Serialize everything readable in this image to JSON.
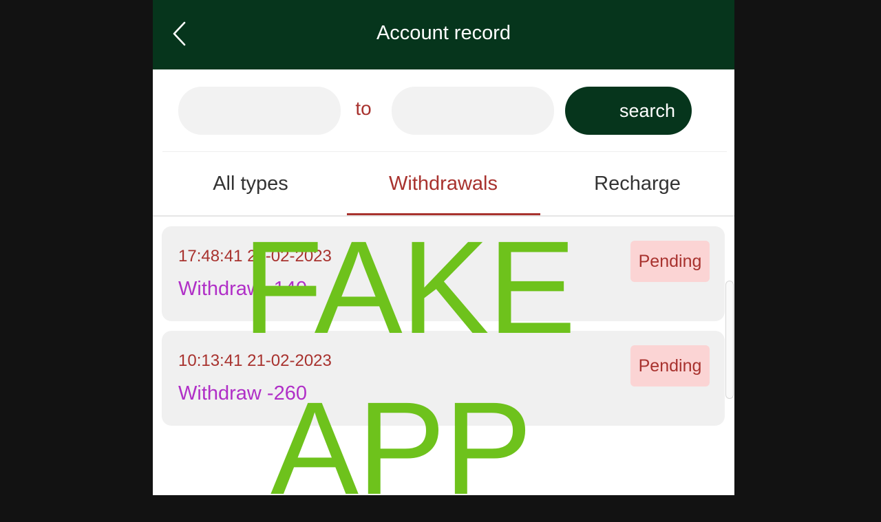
{
  "header": {
    "title": "Account record",
    "back_icon": "chevron-left-icon",
    "background": "#06351c"
  },
  "filter": {
    "from_value": "",
    "to_label": "to",
    "to_value": "",
    "search_label": "search"
  },
  "tabs": [
    {
      "label": "All types",
      "active": false
    },
    {
      "label": "Withdrawals",
      "active": true
    },
    {
      "label": "Recharge",
      "active": false
    }
  ],
  "records": [
    {
      "time": "17:48:41 22-02-2023",
      "amount": "Withdraw -140",
      "status": "Pending"
    },
    {
      "time": "10:13:41 21-02-2023",
      "amount": "Withdraw -260",
      "status": "Pending"
    }
  ],
  "watermark": {
    "line1": "FAKE",
    "line2": "APP",
    "color": "#6ec21c"
  },
  "colors": {
    "accent": "#a8322e",
    "amount": "#b02fc7",
    "badge_bg": "#fbd4d4"
  }
}
